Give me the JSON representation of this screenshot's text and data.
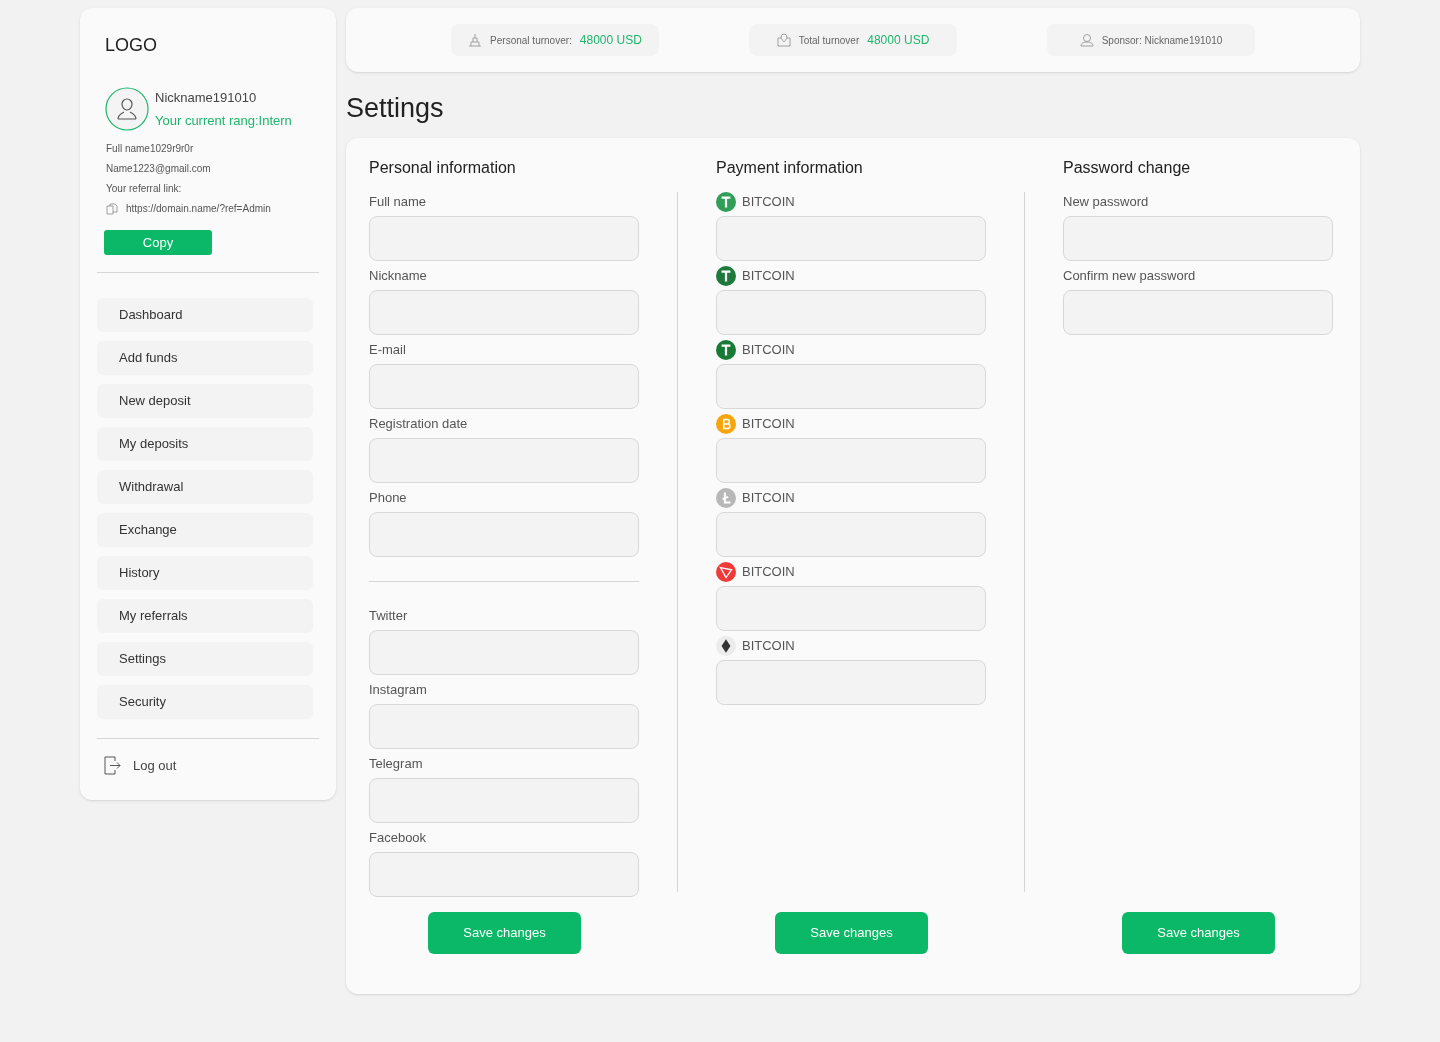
{
  "sidebar": {
    "logo": "LOGO",
    "nickname": "Nickname191010",
    "rank": "Your current rang:Intern",
    "full_name": "Full name1029r9r0r",
    "email": "Name1223@gmail.com",
    "referral_label": "Your referral link:",
    "referral_link": "https://domain.name/?ref=Admin",
    "copy_button": "Copy",
    "nav": [
      {
        "label": "Dashboard"
      },
      {
        "label": "Add funds"
      },
      {
        "label": "New deposit"
      },
      {
        "label": "My deposits"
      },
      {
        "label": "Withdrawal"
      },
      {
        "label": "Exchange"
      },
      {
        "label": "History"
      },
      {
        "label": "My referrals"
      },
      {
        "label": "Settings"
      },
      {
        "label": "Security"
      }
    ],
    "logout": "Log out"
  },
  "stats": [
    {
      "kind": "personal",
      "label": "Personal turnover:",
      "value": "48000 USD"
    },
    {
      "kind": "total",
      "label": "Total turnover",
      "value": "48000 USD"
    },
    {
      "kind": "sponsor",
      "label": "Sponsor: Nickname191010"
    }
  ],
  "title": "Settings",
  "personal": {
    "heading": "Personal information",
    "fields": [
      {
        "label": "Full name"
      },
      {
        "label": "Nickname"
      },
      {
        "label": "E-mail"
      },
      {
        "label": "Registration date"
      },
      {
        "label": "Phone"
      }
    ],
    "social_fields": [
      {
        "label": "Twitter"
      },
      {
        "label": "Instagram"
      },
      {
        "label": "Telegram"
      },
      {
        "label": "Facebook"
      }
    ],
    "save": "Save changes"
  },
  "payment": {
    "heading": "Payment information",
    "fields": [
      {
        "label": "BITCOIN",
        "kind": "tether",
        "color": "#2f9e56"
      },
      {
        "label": "BITCOIN",
        "kind": "tether",
        "color": "#1e7a3c"
      },
      {
        "label": "BITCOIN",
        "kind": "tether",
        "color": "#187a34"
      },
      {
        "label": "BITCOIN",
        "kind": "bitcoin",
        "color": "#f7a50c"
      },
      {
        "label": "BITCOIN",
        "kind": "litecoin",
        "color": "#b8b8b8"
      },
      {
        "label": "BITCOIN",
        "kind": "tron",
        "color": "#ef3a3a"
      },
      {
        "label": "BITCOIN",
        "kind": "ethereum",
        "color": "#ececec"
      }
    ],
    "save": "Save changes"
  },
  "password": {
    "heading": "Password change",
    "fields": [
      {
        "label": "New password"
      },
      {
        "label": "Confirm new password"
      }
    ],
    "save": "Save changes"
  }
}
